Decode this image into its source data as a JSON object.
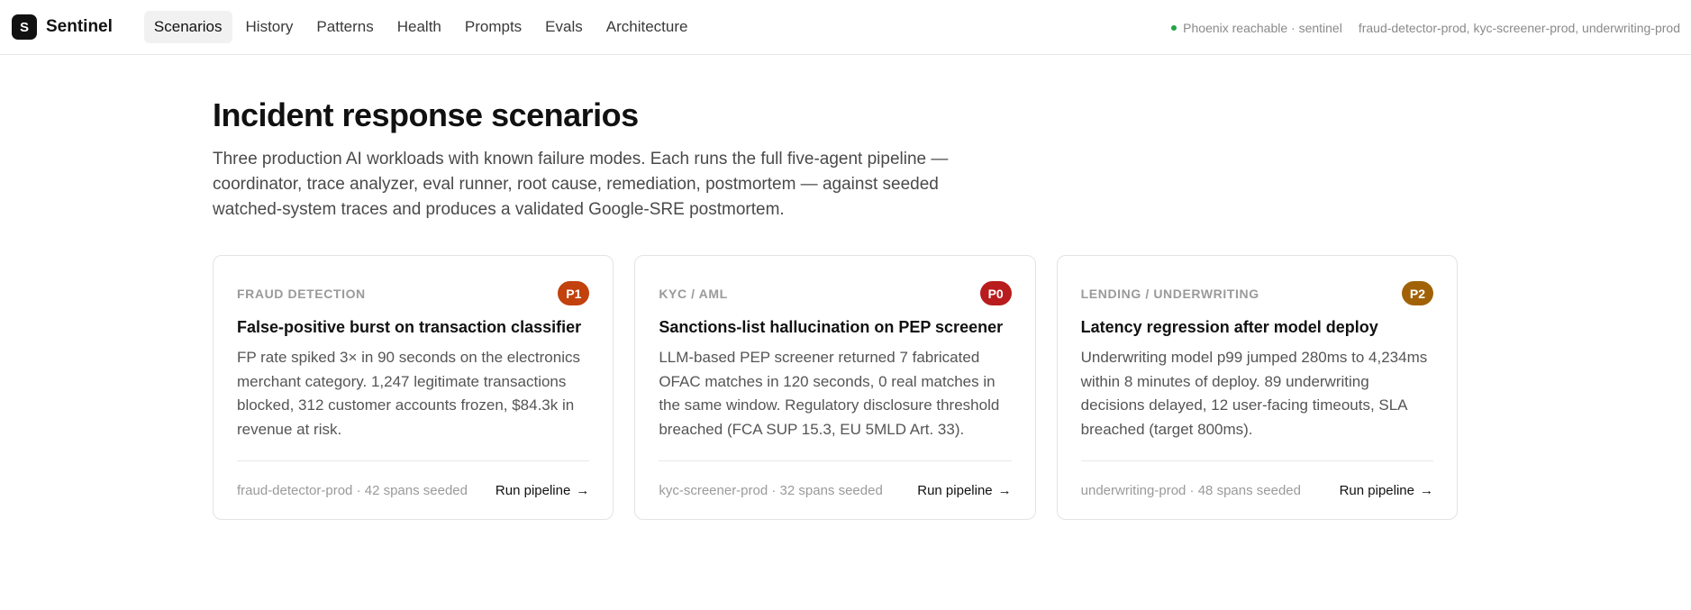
{
  "brand": {
    "logo_letter": "S",
    "name": "Sentinel"
  },
  "nav": {
    "tabs": [
      {
        "label": "Scenarios",
        "active": true
      },
      {
        "label": "History",
        "active": false
      },
      {
        "label": "Patterns",
        "active": false
      },
      {
        "label": "Health",
        "active": false
      },
      {
        "label": "Prompts",
        "active": false
      },
      {
        "label": "Evals",
        "active": false
      },
      {
        "label": "Architecture",
        "active": false
      }
    ]
  },
  "status": {
    "text": "Phoenix reachable · sentinel",
    "projects": "fraud-detector-prod, kyc-screener-prod, underwriting-prod",
    "dot_color": "#22a447"
  },
  "page": {
    "title": "Incident response scenarios",
    "description": "Three production AI workloads with known failure modes. Each runs the full five-agent pipeline — coordinator, trace analyzer, eval runner, root cause, remediation, postmortem — against seeded watched-system traces and produces a validated Google-SRE postmortem."
  },
  "scenarios": [
    {
      "category": "FRAUD DETECTION",
      "severity": "P1",
      "severity_color": "#c2410c",
      "title": "False-positive burst on transaction classifier",
      "description": "FP rate spiked 3× in 90 seconds on the electronics merchant category. 1,247 legitimate transactions blocked, 312 customer accounts frozen, $84.3k in revenue at risk.",
      "meta": "fraud-detector-prod · 42 spans seeded",
      "action": "Run pipeline"
    },
    {
      "category": "KYC / AML",
      "severity": "P0",
      "severity_color": "#b91c1c",
      "title": "Sanctions-list hallucination on PEP screener",
      "description": "LLM-based PEP screener returned 7 fabricated OFAC matches in 120 seconds, 0 real matches in the same window. Regulatory disclosure threshold breached (FCA SUP 15.3, EU 5MLD Art. 33).",
      "meta": "kyc-screener-prod · 32 spans seeded",
      "action": "Run pipeline"
    },
    {
      "category": "LENDING / UNDERWRITING",
      "severity": "P2",
      "severity_color": "#a16207",
      "title": "Latency regression after model deploy",
      "description": "Underwriting model p99 jumped 280ms to 4,234ms within 8 minutes of deploy. 89 underwriting decisions delayed, 12 user-facing timeouts, SLA breached (target 800ms).",
      "meta": "underwriting-prod · 48 spans seeded",
      "action": "Run pipeline"
    }
  ]
}
